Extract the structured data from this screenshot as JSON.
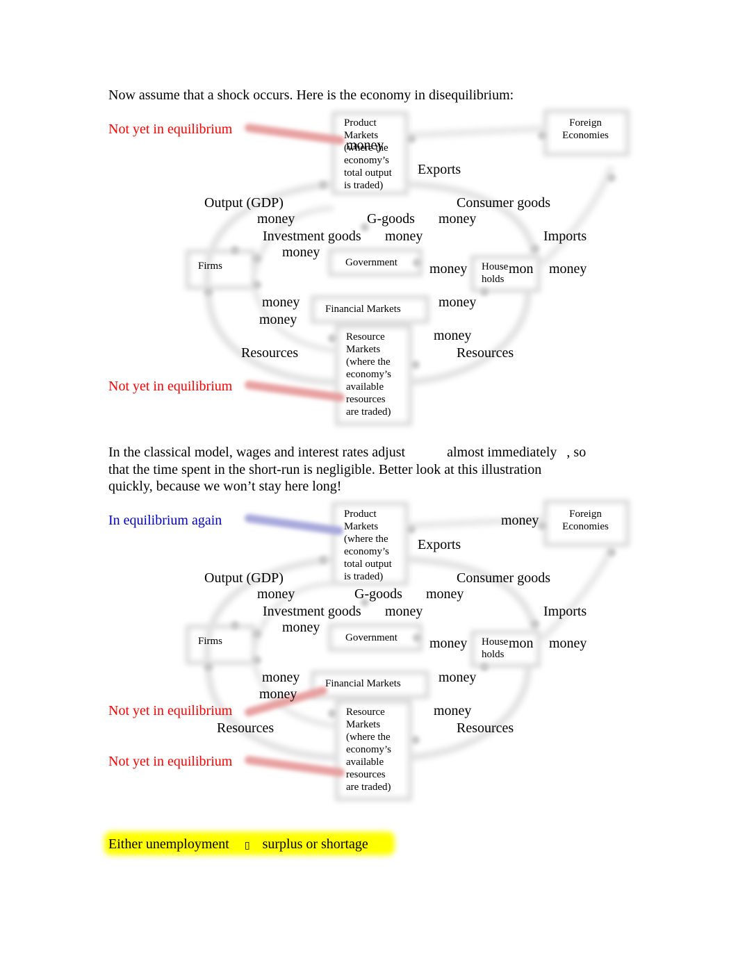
{
  "intro_text": "Now assume that a shock occurs. Here is the economy in disequilibrium:",
  "diagram1": {
    "callouts": [
      {
        "text": "Not yet in equilibrium",
        "color": "#ff0000"
      },
      {
        "text": "Not yet in equilibrium",
        "color": "#ff0000"
      }
    ],
    "boxes": {
      "product_markets": "Product Markets (where the economy’s total output is traded)",
      "product_markets_lines": [
        "Product",
        "Markets",
        "(where the",
        "economy’s",
        "total output",
        "is traded)"
      ],
      "foreign_economies_lines": [
        "Foreign",
        "Economies"
      ],
      "firms": "Firms",
      "government": "Government",
      "households_lines": [
        "House",
        "holds"
      ],
      "financial_markets": "Financial Markets",
      "resource_markets_lines": [
        "Resource",
        "Markets",
        "(where the",
        "economy’s",
        "available",
        "resources",
        "are traded)"
      ]
    },
    "flow_labels": {
      "money_top": "money",
      "exports": "Exports",
      "output_gdp": "Output (GDP)",
      "consumer_goods": "Consumer goods",
      "money_a": "money",
      "g_goods": "G-goods",
      "money_b": "money",
      "investment_goods": "Investment goods",
      "money_c": "money",
      "imports": "Imports",
      "money_d": "money",
      "money_e": "money",
      "mon_fragment": "mon",
      "money_f": "money",
      "money_g": "money",
      "money_h": "money",
      "money_i": "money",
      "money_j": "money",
      "resources_left": "Resources",
      "resources_right": "Resources"
    }
  },
  "middle_paragraph": {
    "line1_a": "In the classical model, wages and interest rates adjust",
    "line1_b": "almost immediately",
    "line1_c": ", so",
    "line2": "that the time spent in the short-run is negligible. Better look at this illustration",
    "line3": "quickly, because we won’t stay here long!"
  },
  "diagram2": {
    "callouts": [
      {
        "text": "In equilibrium again",
        "color": "#0000cc"
      },
      {
        "text": "Not yet in equilibrium",
        "color": "#ff0000"
      },
      {
        "text": "Not yet in equilibrium",
        "color": "#ff0000"
      }
    ],
    "boxes": {
      "product_markets_lines": [
        "Product",
        "Markets",
        "(where the",
        "economy’s",
        "total output",
        "is traded)"
      ],
      "foreign_economies_lines": [
        "Foreign",
        "Economies"
      ],
      "firms": "Firms",
      "government": "Government",
      "households_lines": [
        "House",
        "holds"
      ],
      "financial_markets": "Financial Markets",
      "resource_markets_lines": [
        "Resource",
        "Markets",
        "(where the",
        "economy’s",
        "available",
        "resources",
        "are traded)"
      ]
    },
    "flow_labels": {
      "money_top": "money",
      "exports": "Exports",
      "output_gdp": "Output (GDP)",
      "consumer_goods": "Consumer goods",
      "money_a": "money",
      "g_goods": "G-goods",
      "money_b": "money",
      "investment_goods": "Investment goods",
      "money_c": "money",
      "imports": "Imports",
      "money_d": "money",
      "money_e": "money",
      "mon_fragment": "mon",
      "money_f": "money",
      "money_g": "money",
      "money_h": "money",
      "money_i": "money",
      "money_j": "money",
      "resources_left": "Resources",
      "resources_right": "Resources"
    }
  },
  "conclusion": {
    "part1": "Either unemployment",
    "arrow_glyph": "▯",
    "part2": "surplus or shortage",
    "highlight_color": "#ffff00"
  }
}
